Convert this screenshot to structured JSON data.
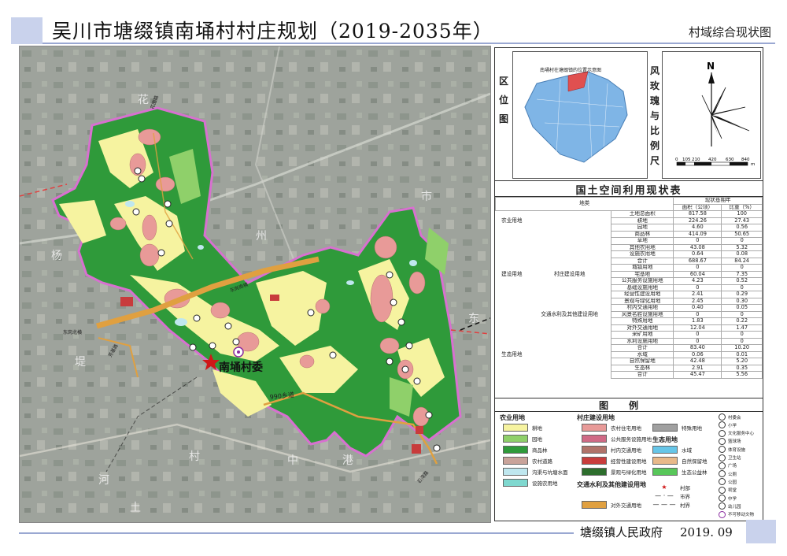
{
  "header": {
    "title": "吴川市塘缀镇南埇村村庄规划（2019-2035年）",
    "subtitle": "村域综合现状图"
  },
  "map": {
    "village_label": "南埇村委",
    "road_label_990": "990乡道",
    "road_label_east1": "东岗南横",
    "road_label_east2": "东岗北横",
    "road_label_fangji": "芳基路",
    "road_label_huawei": "花围路",
    "road_label_shiwan": "石湾路",
    "region_labels": [
      "花",
      "杨",
      "州",
      "市",
      "东",
      "中",
      "村",
      "堤",
      "港",
      "土",
      "河"
    ]
  },
  "location_panel": {
    "label_chars": [
      "区",
      "位",
      "图"
    ],
    "inset_title": "南埇村在塘缀镇的位置示意图",
    "compass_label_chars": [
      "风",
      "玫",
      "瑰",
      "与",
      "比",
      "例",
      "尺"
    ],
    "north": "N",
    "scale_ticks": [
      "0",
      "105",
      "210",
      "420",
      "630",
      "840"
    ],
    "scale_unit": "m"
  },
  "table": {
    "title": "国土空间利用现状表",
    "head_col1": "地类",
    "head_period": "现状基期年",
    "head_area": "面积（公顷）",
    "head_ratio": "比重（%）",
    "rows": [
      {
        "g": "",
        "s": "",
        "n": "土地总面积",
        "a": "817.58",
        "r": "100"
      },
      {
        "g": "农业用地",
        "s": "",
        "n": "耕地",
        "a": "224.26",
        "r": "27.43"
      },
      {
        "g": "",
        "s": "",
        "n": "园地",
        "a": "4.60",
        "r": "0.56"
      },
      {
        "g": "",
        "s": "",
        "n": "商品林",
        "a": "414.09",
        "r": "50.65"
      },
      {
        "g": "",
        "s": "",
        "n": "草地",
        "a": "0",
        "r": "0"
      },
      {
        "g": "",
        "s": "",
        "n": "其他农用地",
        "a": "43.08",
        "r": "5.32"
      },
      {
        "g": "",
        "s": "",
        "n": "设施农用地",
        "a": "0.64",
        "r": "0.08"
      },
      {
        "g": "",
        "s": "",
        "n": "合计",
        "a": "688.67",
        "r": "84.24"
      },
      {
        "g": "",
        "s": "",
        "n": "城镇用地",
        "a": "0",
        "r": "0"
      },
      {
        "g": "建设用地",
        "s": "村庄建设用地",
        "n": "宅基地",
        "a": "60.04",
        "r": "7.35"
      },
      {
        "g": "",
        "s": "",
        "n": "公共服务设施用地",
        "a": "4.23",
        "r": "0.52"
      },
      {
        "g": "",
        "s": "",
        "n": "基础设施用地",
        "a": "0",
        "r": "0"
      },
      {
        "g": "",
        "s": "",
        "n": "经营性建设用地",
        "a": "2.41",
        "r": "0.29"
      },
      {
        "g": "",
        "s": "",
        "n": "景观与绿化用地",
        "a": "2.45",
        "r": "0.30"
      },
      {
        "g": "",
        "s": "",
        "n": "村内交通用地",
        "a": "0.40",
        "r": "0.05"
      },
      {
        "g": "",
        "s": "交通水利及其他建设用地",
        "n": "风景名胜设施用地",
        "a": "0",
        "r": "0"
      },
      {
        "g": "",
        "s": "",
        "n": "特殊用地",
        "a": "1.83",
        "r": "0.22"
      },
      {
        "g": "",
        "s": "",
        "n": "对外交通用地",
        "a": "12.04",
        "r": "1.47"
      },
      {
        "g": "",
        "s": "",
        "n": "采矿用地",
        "a": "0",
        "r": "0"
      },
      {
        "g": "",
        "s": "",
        "n": "水利设施用地",
        "a": "0",
        "r": "0"
      },
      {
        "g": "",
        "s": "",
        "n": "合计",
        "a": "83.40",
        "r": "10.20"
      },
      {
        "g": "生态用地",
        "s": "",
        "n": "水域",
        "a": "0.06",
        "r": "0.01"
      },
      {
        "g": "",
        "s": "",
        "n": "自然保留地",
        "a": "42.48",
        "r": "5.20"
      },
      {
        "g": "",
        "s": "",
        "n": "生态林",
        "a": "2.91",
        "r": "0.35"
      },
      {
        "g": "",
        "s": "",
        "n": "合计",
        "a": "45.47",
        "r": "5.56"
      }
    ]
  },
  "legend": {
    "title": "图例",
    "agri_head": "农业用地",
    "agri": [
      {
        "label": "耕地",
        "color": "#f6f3a0"
      },
      {
        "label": "园地",
        "color": "#8fd06a"
      },
      {
        "label": "商品林",
        "color": "#2f9a3a"
      },
      {
        "label": "农村道路",
        "color": "#c9a39a"
      },
      {
        "label": "沟渠与坑塘水面",
        "color": "#bfe7ef"
      },
      {
        "label": "设施农用地",
        "color": "#7fd8cf"
      }
    ],
    "village_head": "村庄建设用地",
    "village": [
      {
        "label": "农村住宅用地",
        "color": "#e89a98"
      },
      {
        "label": "公共服务设施用地",
        "color": "#d06a86"
      },
      {
        "label": "村内交通用地",
        "color": "#b0736a"
      },
      {
        "label": "经营性建设用地",
        "color": "#c83c3c"
      },
      {
        "label": "景观与绿化用地",
        "color": "#2d6e2d"
      }
    ],
    "transport_head": "交通水利及其他建设用地",
    "transport": [
      {
        "label": "对外交通用地",
        "color": "#e0a040"
      }
    ],
    "special": [
      {
        "label": "特殊用地",
        "color": "#a0a0a0"
      }
    ],
    "eco_head": "生态用地",
    "eco": [
      {
        "label": "水域",
        "color": "#67c6e8"
      },
      {
        "label": "自然保留地",
        "color": "#e8b98a"
      },
      {
        "label": "生态公益林",
        "color": "#58c75a"
      }
    ],
    "markers": [
      {
        "label": "村部"
      },
      {
        "label": "市界"
      },
      {
        "label": "村界"
      }
    ],
    "icons": [
      "村委会",
      "小学",
      "文化服务中心",
      "篮球场",
      "体育设施",
      "卫生站",
      "广场",
      "公厕",
      "公园",
      "祠堂",
      "中学",
      "幼儿园",
      "不可移动文物"
    ]
  },
  "footer": {
    "org": "塘缀镇人民政府",
    "date": "2019. 09"
  }
}
